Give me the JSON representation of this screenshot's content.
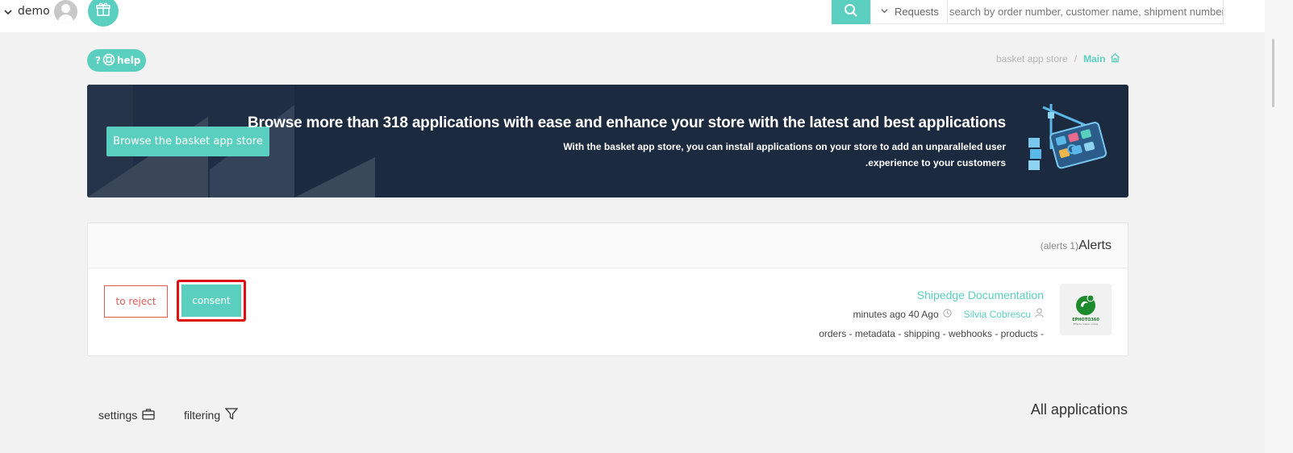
{
  "topbar": {
    "user_name": "demo",
    "requests_label": "Requests",
    "search_placeholder": "search by order number, customer name, shipment number"
  },
  "help": {
    "label": "help"
  },
  "breadcrumb": {
    "store": "basket app store",
    "separator": "/",
    "main": "Main"
  },
  "banner": {
    "button_label": "Browse the basket app store",
    "title": "Browse more than 318 applications with ease and enhance your store with the latest and best applications",
    "description": "With the basket app store, you can install applications on your store to add an unparalleled user .experience to your customers"
  },
  "alerts": {
    "count_label": "(alerts 1)",
    "title": "Alerts",
    "reject_label": "to reject",
    "consent_label": "consent",
    "item": {
      "app_name": "Shipedge Documentation",
      "author": "Silvia Cobrescu",
      "time": "minutes ago 40 Ago",
      "tags": "orders - metadata - shipping - webhooks - products -",
      "logo_text": "EPHOTO360",
      "logo_sub": "Effects maker online"
    }
  },
  "bottom": {
    "settings_label": "settings",
    "filtering_label": "filtering",
    "all_apps_label": "All applications"
  },
  "colors": {
    "accent": "#5bcfbf",
    "banner": "#1c2a40",
    "danger": "#e05a5a",
    "highlight": "#e01010"
  }
}
